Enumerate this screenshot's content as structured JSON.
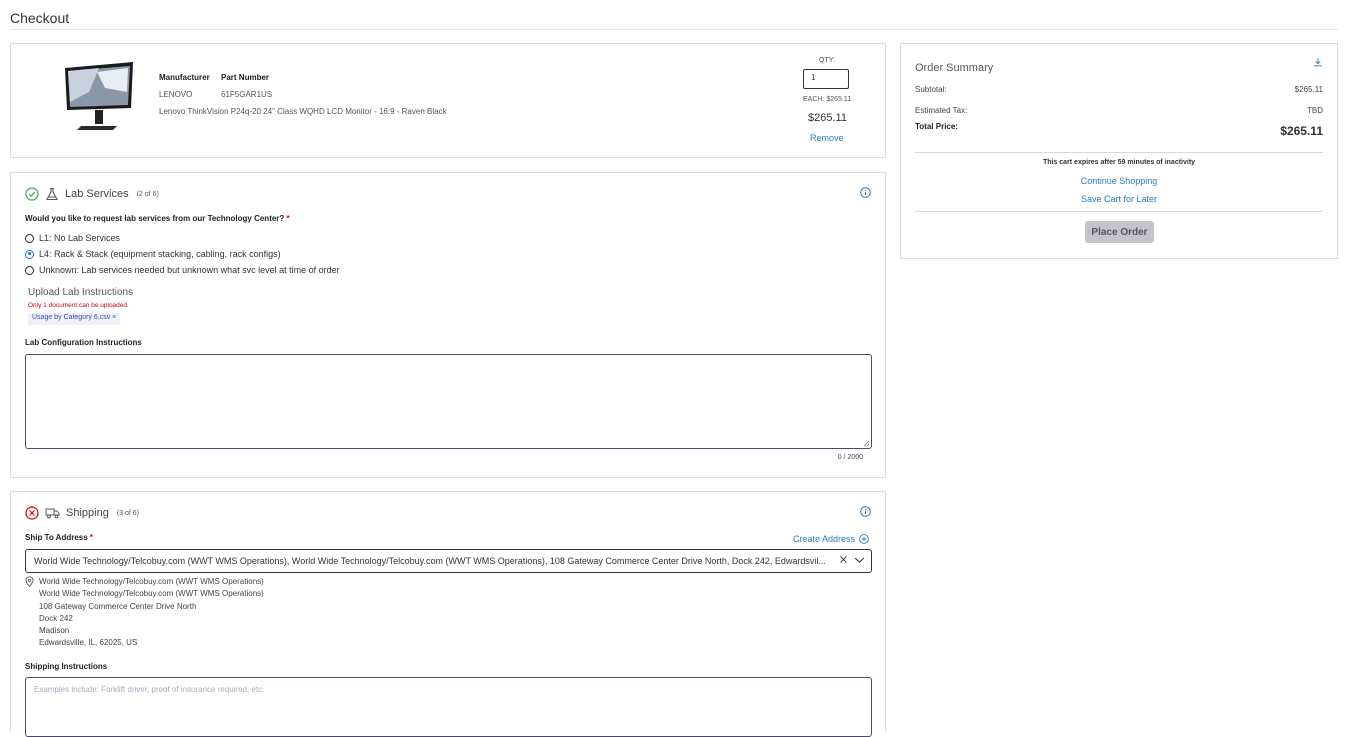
{
  "page": {
    "title": "Checkout"
  },
  "product": {
    "manufacturer_label": "Manufacturer",
    "part_number_label": "Part Number",
    "manufacturer": "LENOVO",
    "part_number": "61F5GAR1US",
    "description": "Lenovo ThinkVision P24q-20 24\" Class WQHD LCD Monitor - 16:9 - Raven Black",
    "qty_label": "QTY:",
    "qty_value": "1",
    "each_price": "EACH: $265.11",
    "line_price": "$265.11",
    "remove_label": "Remove"
  },
  "lab_services": {
    "title": "Lab Services",
    "step": "(2 of 6)",
    "question": "Would you like to request lab services from our Technology Center?",
    "required_mark": "*",
    "options": [
      {
        "label": "L1: No Lab Services",
        "checked": false
      },
      {
        "label": "L4: Rack & Stack (equipment stacking, cabling, rack configs)",
        "checked": true
      },
      {
        "label": "Unknown: Lab services needed but unknown what svc level at time of order",
        "checked": false
      }
    ],
    "upload_label": "Upload Lab Instructions",
    "upload_error": "Only 1 document can be uploaded.",
    "file_chip": "Usage by Category 6.csv ×",
    "config_label": "Lab Configuration Instructions",
    "char_count": "0 / 2000"
  },
  "shipping": {
    "title": "Shipping",
    "step": "(3 of 6)",
    "ship_to_label": "Ship To Address",
    "required_mark": "*",
    "create_address": "Create Address",
    "selected_address": "World Wide Technology/Telcobuy.com (WWT WMS Operations), World Wide Technology/Telcobuy.com (WWT WMS Operations), 108 Gateway Commerce Center Drive North, Dock 242, Edwardsvil...",
    "address_lines": [
      "World Wide Technology/Telcobuy.com (WWT WMS Operations)",
      "World Wide Technology/Telcobuy.com (WWT WMS Operations)",
      "108 Gateway Commerce Center Drive North",
      "Dock 242",
      "Madison",
      "Edwardsville, IL, 62025, US"
    ],
    "instructions_label": "Shipping Instructions",
    "instructions_placeholder": "Examples include: Forklift driver, proof of insurance required, etc."
  },
  "summary": {
    "title": "Order Summary",
    "subtotal_label": "Subtotal:",
    "subtotal_value": "$265.11",
    "tax_label": "Estimated Tax:",
    "tax_value": "TBD",
    "total_label": "Total Price:",
    "total_value": "$265.11",
    "expire_text": "This cart expires after 59 minutes of inactivity",
    "continue_label": "Continue Shopping",
    "save_label": "Save Cart for Later",
    "place_order_label": "Place Order"
  },
  "colors": {
    "link": "#2a7ab8",
    "success": "#3aa35c",
    "error": "#d0021b",
    "radio_checked": "#1f6fd6"
  }
}
